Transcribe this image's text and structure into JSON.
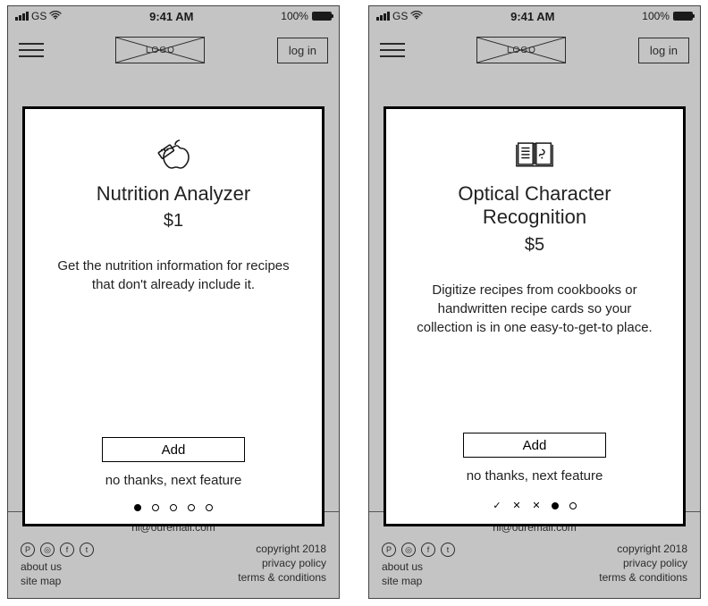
{
  "status": {
    "carrier": "GS",
    "time": "9:41 AM",
    "battery_pct": "100%"
  },
  "header": {
    "logo_text": "LOGO",
    "login_label": "log in"
  },
  "footer": {
    "email": "hi@ouremail.com",
    "about": "about us",
    "sitemap": "site map",
    "copyright": "copyright 2018",
    "privacy": "privacy policy",
    "terms": "terms & conditions"
  },
  "common": {
    "add_label": "Add",
    "skip_label": "no thanks, next feature"
  },
  "screens": [
    {
      "title": "Nutrition Analyzer",
      "price": "$1",
      "description": "Get the nutrition information for recipes that don't already include it.",
      "pager": {
        "type": "dots",
        "count": 5,
        "active_index": 0
      }
    },
    {
      "title": "Optical Character Recognition",
      "price": "$5",
      "description": "Digitize recipes from cookbooks or handwritten recipe cards so your collection is in one easy-to-get-to place.",
      "pager": {
        "type": "marks",
        "states": [
          "check",
          "cross",
          "cross",
          "filled",
          "empty"
        ]
      }
    }
  ]
}
